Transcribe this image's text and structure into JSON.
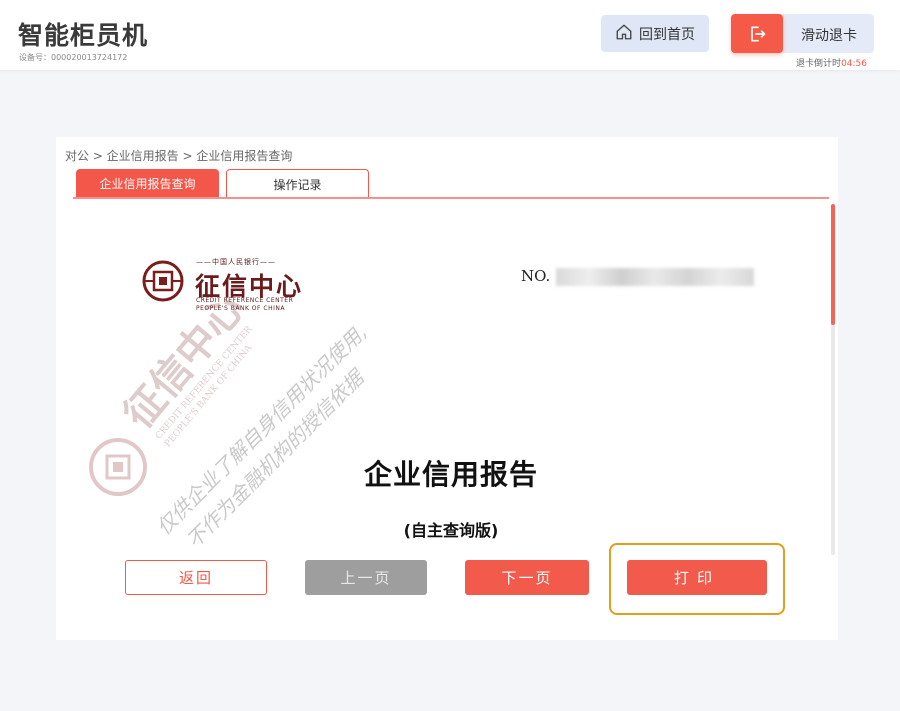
{
  "header": {
    "title": "智能柜员机",
    "device_id": "设备号：000020013724172",
    "home_label": "回到首页",
    "exit_label": "滑动退卡",
    "countdown_label": "退卡倒计时",
    "countdown_time": "04:56"
  },
  "breadcrumb": "对公 > 企业信用报告 > 企业信用报告查询",
  "tabs": [
    {
      "label": "企业信用报告查询",
      "active": true
    },
    {
      "label": "操作记录",
      "active": false
    }
  ],
  "report": {
    "logo_top": "——中国人民银行——",
    "logo_text": "征信中心",
    "logo_en1": "CREDIT REFERENCE CENTER",
    "logo_en2": "PEOPLE'S BANK OF CHINA",
    "no_label": "NO.",
    "title": "企业信用报告",
    "subtitle": "(自主查询版)",
    "watermark_line1": "仅供企业了解自身信用状况使用,",
    "watermark_line2": "不作为金融机构的授信依据"
  },
  "buttons": {
    "back": "返回",
    "prev": "上一页",
    "next": "下一页",
    "print": "打印"
  },
  "colors": {
    "accent": "#f25a4c",
    "highlight": "#e69c1c",
    "disabled": "#9e9e9e"
  }
}
